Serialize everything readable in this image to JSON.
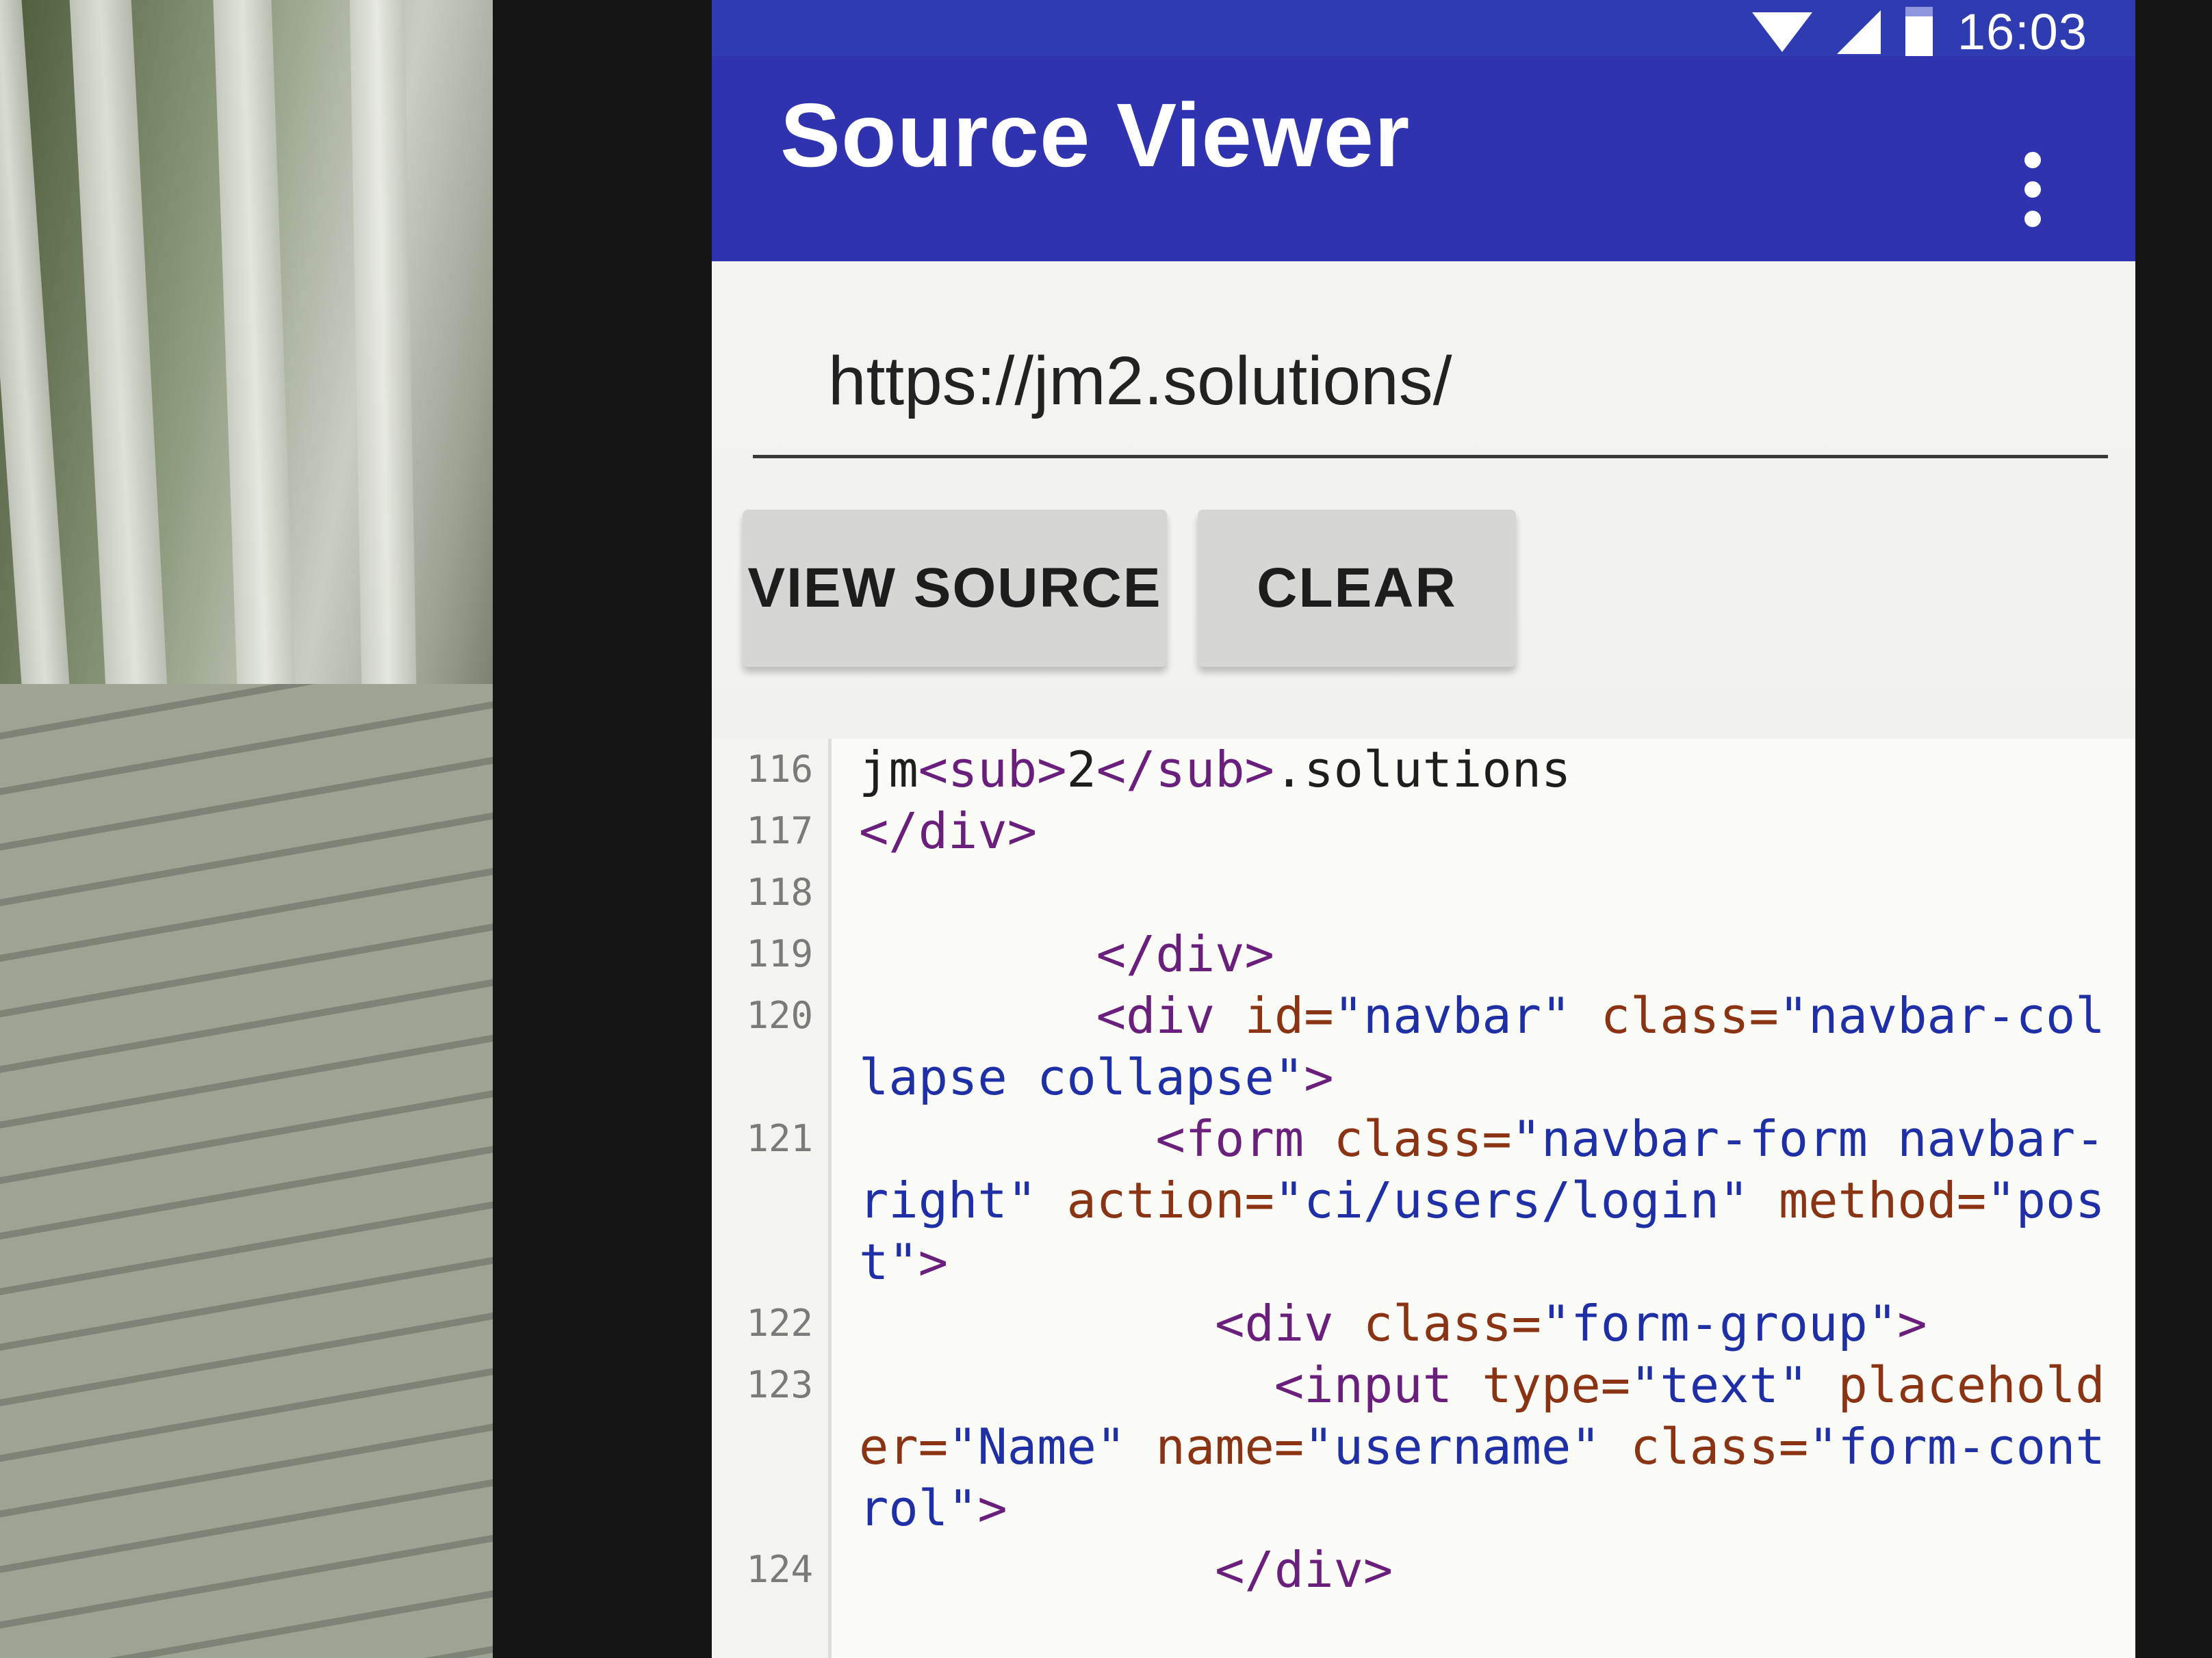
{
  "status_bar": {
    "time": "16:03",
    "icons": [
      "wifi-icon",
      "signal-icon",
      "battery-icon"
    ]
  },
  "app_bar": {
    "title": "Source Viewer",
    "menu_icon": "more-vert-icon"
  },
  "url_field": {
    "value": "https://jm2.solutions/"
  },
  "buttons": {
    "view_source": "VIEW SOURCE",
    "clear": "CLEAR"
  },
  "colors": {
    "app_bar": "#3033b0",
    "status_bar": "#2f3bb0",
    "tag": "#6b1f7c",
    "attribute": "#8a3414",
    "string": "#1f2fa6"
  },
  "source_lines": [
    {
      "number": "116",
      "parts": [
        {
          "t": "txt",
          "v": "jm"
        },
        {
          "t": "tag",
          "v": "<sub>"
        },
        {
          "t": "txt",
          "v": "2"
        },
        {
          "t": "tag",
          "v": "</sub>"
        },
        {
          "t": "txt",
          "v": ".solutions"
        }
      ]
    },
    {
      "number": "117",
      "parts": [
        {
          "t": "tag",
          "v": "</div>"
        }
      ]
    },
    {
      "number": "118",
      "parts": []
    },
    {
      "number": "119",
      "parts": [
        {
          "t": "txt",
          "v": "        "
        },
        {
          "t": "tag",
          "v": "</div>"
        }
      ]
    },
    {
      "number": "120",
      "parts": [
        {
          "t": "txt",
          "v": "        "
        },
        {
          "t": "tag",
          "v": "<div "
        },
        {
          "t": "attr",
          "v": "id="
        },
        {
          "t": "str",
          "v": "\"navbar\""
        },
        {
          "t": "txt",
          "v": " "
        },
        {
          "t": "attr",
          "v": "class="
        },
        {
          "t": "str",
          "v": "\"navbar-collapse collapse\""
        },
        {
          "t": "tag",
          "v": ">"
        }
      ]
    },
    {
      "number": "121",
      "parts": [
        {
          "t": "txt",
          "v": "          "
        },
        {
          "t": "tag",
          "v": "<form "
        },
        {
          "t": "attr",
          "v": "class="
        },
        {
          "t": "str",
          "v": "\"navbar-form navbar-right\""
        },
        {
          "t": "txt",
          "v": " "
        },
        {
          "t": "attr",
          "v": "action="
        },
        {
          "t": "str",
          "v": "\"ci/users/login\""
        },
        {
          "t": "txt",
          "v": " "
        },
        {
          "t": "attr",
          "v": "method="
        },
        {
          "t": "str",
          "v": "\"post\""
        },
        {
          "t": "tag",
          "v": ">"
        }
      ]
    },
    {
      "number": "122",
      "parts": [
        {
          "t": "txt",
          "v": "            "
        },
        {
          "t": "tag",
          "v": "<div "
        },
        {
          "t": "attr",
          "v": "class="
        },
        {
          "t": "str",
          "v": "\"form-group\""
        },
        {
          "t": "tag",
          "v": ">"
        }
      ]
    },
    {
      "number": "123",
      "parts": [
        {
          "t": "txt",
          "v": "              "
        },
        {
          "t": "tag",
          "v": "<input "
        },
        {
          "t": "attr",
          "v": "type="
        },
        {
          "t": "str",
          "v": "\"text\""
        },
        {
          "t": "txt",
          "v": " "
        },
        {
          "t": "attr",
          "v": "placeholder="
        },
        {
          "t": "str",
          "v": "\"Name\""
        },
        {
          "t": "txt",
          "v": " "
        },
        {
          "t": "attr",
          "v": "name="
        },
        {
          "t": "str",
          "v": "\"username\""
        },
        {
          "t": "txt",
          "v": " "
        },
        {
          "t": "attr",
          "v": "class="
        },
        {
          "t": "str",
          "v": "\"form-control\""
        },
        {
          "t": "tag",
          "v": ">"
        }
      ]
    },
    {
      "number": "124",
      "parts": [
        {
          "t": "txt",
          "v": "            "
        },
        {
          "t": "tag",
          "v": "</div>"
        }
      ]
    }
  ]
}
